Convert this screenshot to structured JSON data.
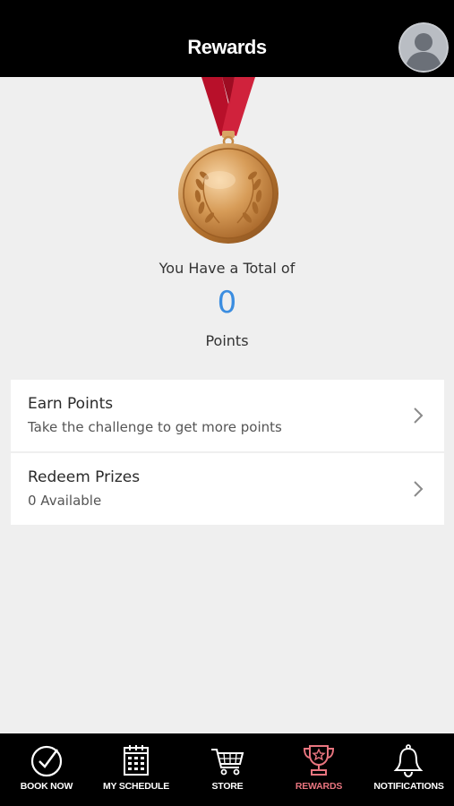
{
  "header": {
    "title": "Rewards",
    "avatar_icon": "user-avatar-icon"
  },
  "summary": {
    "total_label": "You Have a Total of",
    "points": "0",
    "points_label": "Points",
    "medal_icon": "gold-medal-icon"
  },
  "cards": {
    "earn": {
      "title": "Earn Points",
      "subtitle": "Take the challenge to get more points"
    },
    "redeem": {
      "title": "Redeem Prizes",
      "subtitle": "0 Available"
    }
  },
  "nav": {
    "items": [
      {
        "label": "BOOK NOW",
        "icon": "check-circle-icon"
      },
      {
        "label": "MY SCHEDULE",
        "icon": "calendar-icon"
      },
      {
        "label": "STORE",
        "icon": "cart-icon"
      },
      {
        "label": "REWARDS",
        "icon": "trophy-icon",
        "active": true
      },
      {
        "label": "NOTIFICATIONS",
        "icon": "bell-icon"
      }
    ]
  },
  "colors": {
    "header_bg": "#000000",
    "page_bg": "#efefef",
    "points_blue": "#3b8de0",
    "active_nav": "#e8757f",
    "ribbon_red": "#b8102a",
    "medal_gold": "#c8863a"
  }
}
